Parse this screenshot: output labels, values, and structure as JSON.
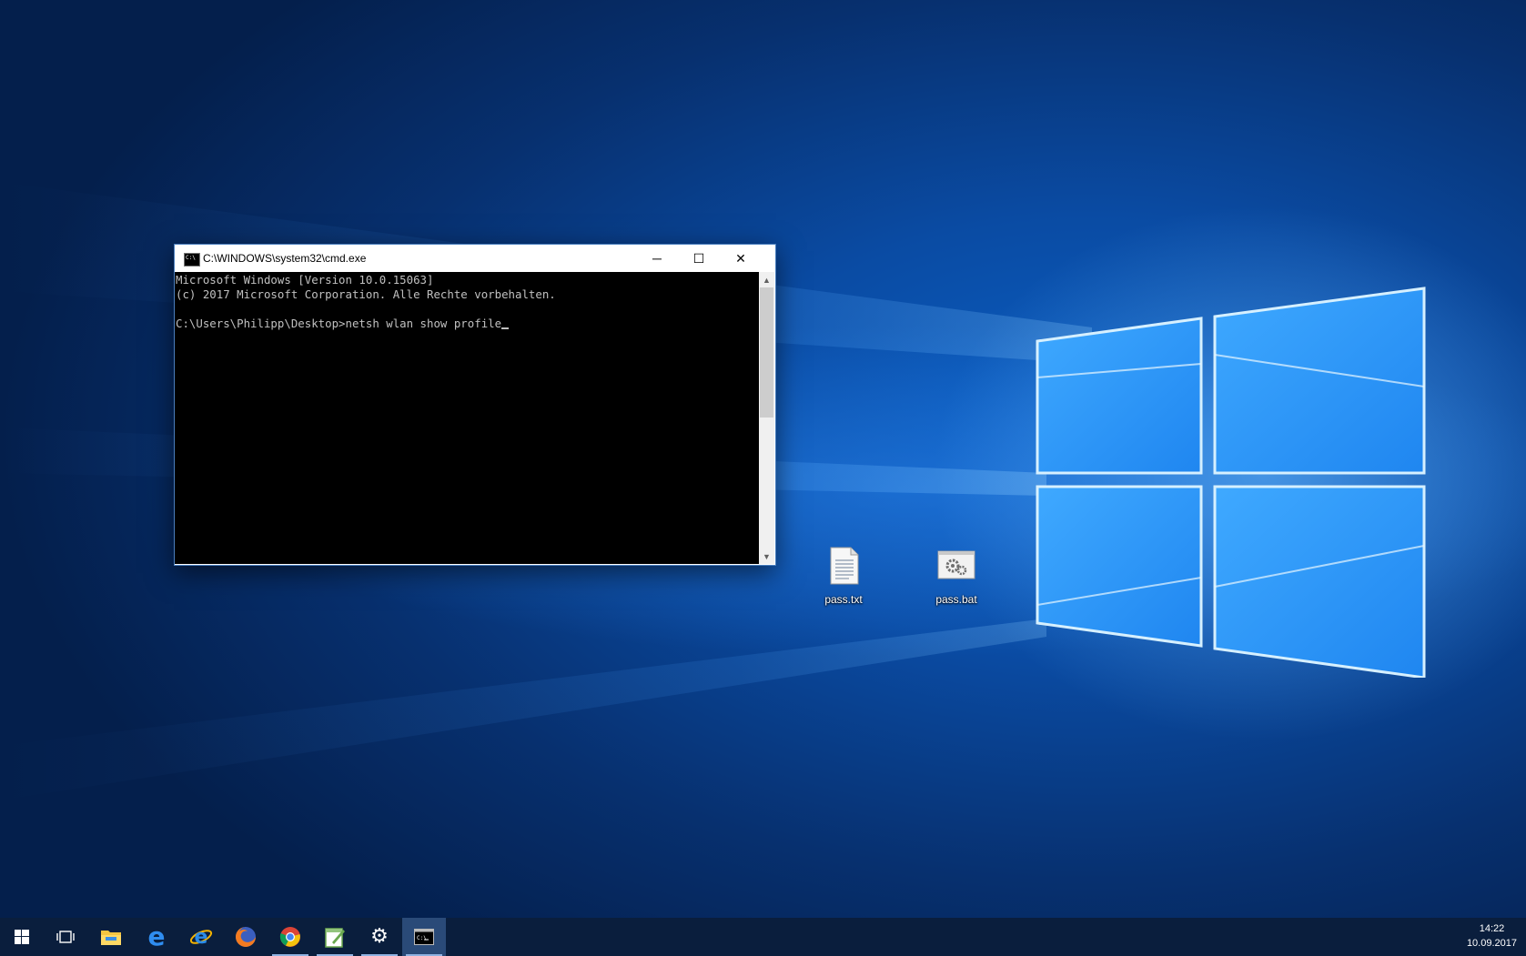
{
  "window": {
    "title": "C:\\WINDOWS\\system32\\cmd.exe",
    "console_lines": [
      "Microsoft Windows [Version 10.0.15063]",
      "(c) 2017 Microsoft Corporation. Alle Rechte vorbehalten.",
      "",
      "C:\\Users\\Philipp\\Desktop>netsh wlan show profile"
    ],
    "controls": {
      "minimize": "─",
      "maximize": "☐",
      "close": "✕"
    }
  },
  "desktop_icons": [
    {
      "label": "pass.txt",
      "icon": "text-file-icon"
    },
    {
      "label": "pass.bat",
      "icon": "batch-file-icon"
    }
  ],
  "taskbar": {
    "items": [
      {
        "name": "start-button",
        "icon": "windows-logo-icon"
      },
      {
        "name": "task-view-button",
        "icon": "task-view-icon"
      },
      {
        "name": "file-explorer-button",
        "icon": "folder-icon"
      },
      {
        "name": "edge-button",
        "icon": "edge-icon"
      },
      {
        "name": "internet-explorer-button",
        "icon": "internet-explorer-icon"
      },
      {
        "name": "firefox-button",
        "icon": "firefox-icon"
      },
      {
        "name": "chrome-button",
        "icon": "chrome-icon"
      },
      {
        "name": "notepad-plus-button",
        "icon": "notepad-icon"
      },
      {
        "name": "settings-button",
        "icon": "gear-icon"
      },
      {
        "name": "cmd-button",
        "icon": "command-prompt-icon"
      }
    ],
    "clock": {
      "time": "14:22",
      "date": "10.09.2017"
    }
  },
  "colors": {
    "taskbar": "#0a1e3d",
    "accent": "#0a5fc4",
    "console_bg": "#000000",
    "console_fg": "#c0c0c0"
  }
}
